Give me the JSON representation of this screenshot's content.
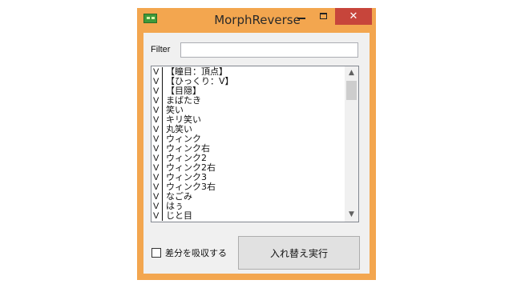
{
  "window": {
    "title": "MorphReverse",
    "minimize_glyph": "–",
    "maximize_glyph": "□",
    "close_glyph": "✕",
    "accent_color": "#f3a64f",
    "close_color": "#c7453b"
  },
  "filter": {
    "label": "Filter",
    "value": ""
  },
  "list": {
    "items": [
      {
        "check": "V",
        "name": "【瞳目：頂点】"
      },
      {
        "check": "V",
        "name": "【ひっくり：V】"
      },
      {
        "check": "V",
        "name": "【目隠】"
      },
      {
        "check": "V",
        "name": "まばたき"
      },
      {
        "check": "V",
        "name": "笑い"
      },
      {
        "check": "V",
        "name": "キリ笑い"
      },
      {
        "check": "V",
        "name": "丸笑い"
      },
      {
        "check": "V",
        "name": "ウィンク"
      },
      {
        "check": "V",
        "name": "ウィンク右"
      },
      {
        "check": "V",
        "name": "ウィンク2"
      },
      {
        "check": "V",
        "name": "ウィンク2右"
      },
      {
        "check": "V",
        "name": "ウィンク3"
      },
      {
        "check": "V",
        "name": "ウィンク3右"
      },
      {
        "check": "V",
        "name": "なごみ"
      },
      {
        "check": "V",
        "name": "はぅ"
      },
      {
        "check": "V",
        "name": "じと目"
      }
    ]
  },
  "absorb_diff": {
    "label": "差分を吸収する",
    "checked": false
  },
  "execute_button": {
    "label": "入れ替え実行"
  }
}
